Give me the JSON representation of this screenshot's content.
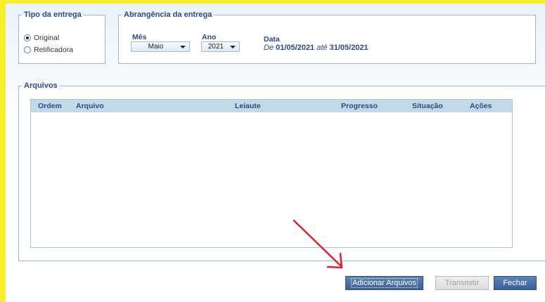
{
  "tipo_entrega": {
    "title": "Tipo da entrega",
    "options": [
      {
        "label": "Original",
        "selected": true
      },
      {
        "label": "Retificadora",
        "selected": false
      }
    ]
  },
  "abrangencia": {
    "title": "Abrangência da entrega",
    "mes_label": "Mês",
    "mes_value": "Maio",
    "ano_label": "Ano",
    "ano_value": "2021",
    "data_label": "Data",
    "data_de": "De",
    "data_inicio": "01/05/2021",
    "data_ate": "até",
    "data_fim": "31/05/2021"
  },
  "arquivos": {
    "title": "Arquivos",
    "columns": [
      "Ordem",
      "Arquivo",
      "Leiaute",
      "Progresso",
      "Situação",
      "Ações"
    ],
    "rows": []
  },
  "buttons": {
    "adicionar": "Adicionar Arquivos",
    "transmitir": "Transmitir",
    "fechar": "Fechar"
  },
  "colors": {
    "highlight_frame": "#f7ef2a",
    "label_blue": "#2a4a86",
    "button_blue": "#3b5f98",
    "annotation_arrow": "#e0202a"
  }
}
